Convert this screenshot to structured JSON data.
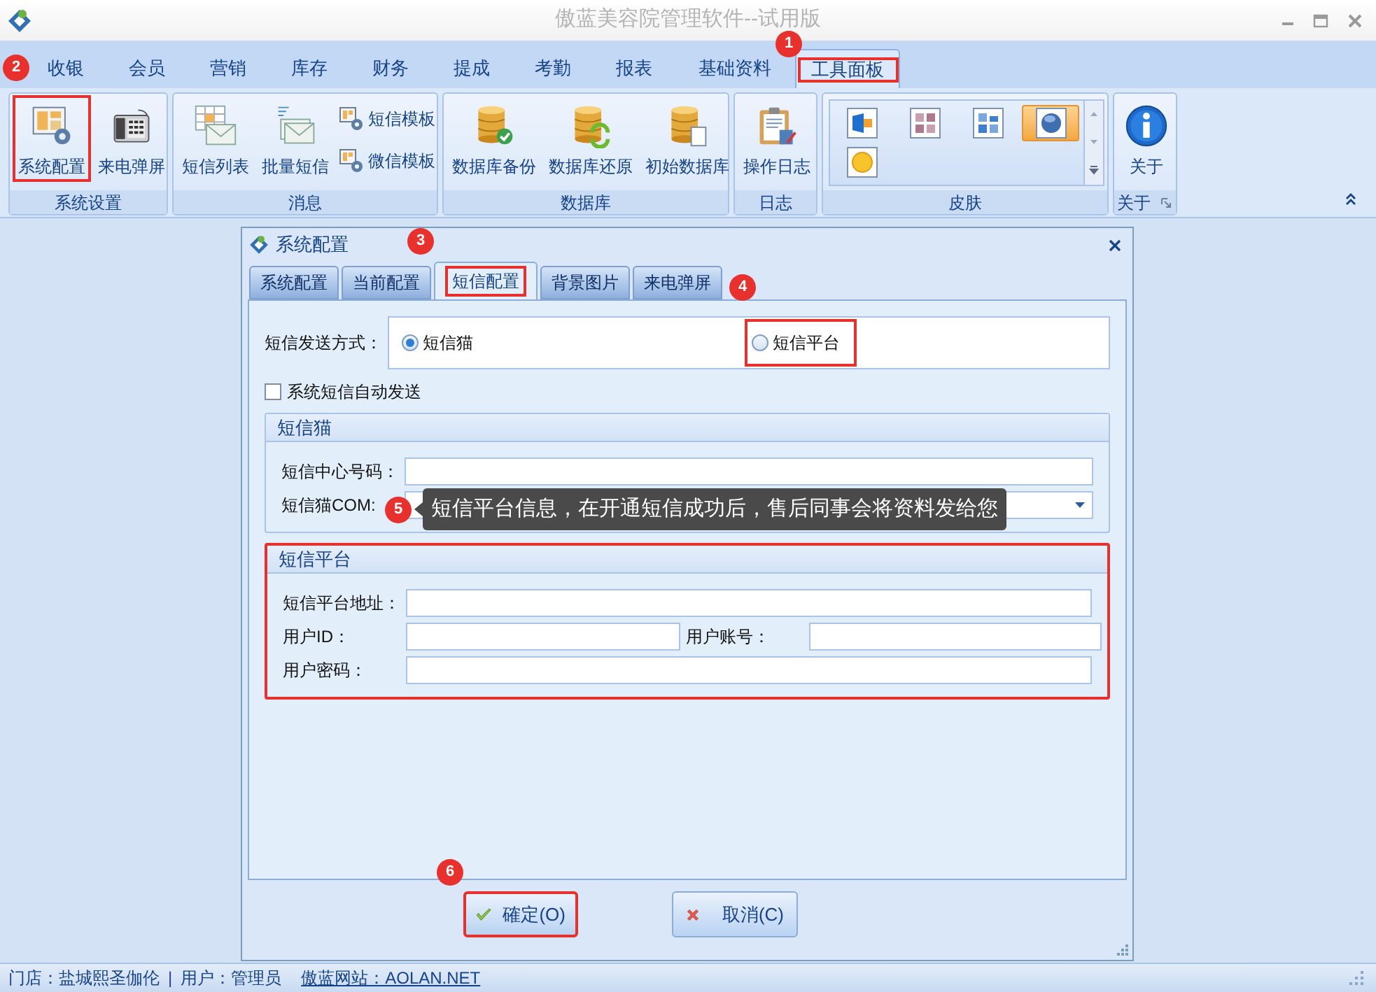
{
  "window": {
    "title": "傲蓝美容院管理软件--试用版"
  },
  "ribbon": {
    "tabs": [
      {
        "label": "收银",
        "selected": false
      },
      {
        "label": "会员",
        "selected": false
      },
      {
        "label": "营销",
        "selected": false
      },
      {
        "label": "库存",
        "selected": false
      },
      {
        "label": "财务",
        "selected": false
      },
      {
        "label": "提成",
        "selected": false
      },
      {
        "label": "考勤",
        "selected": false
      },
      {
        "label": "报表",
        "selected": false
      },
      {
        "label": "基础资料",
        "selected": false
      },
      {
        "label": "工具面板",
        "selected": true,
        "highlighted": true,
        "callout": "1"
      }
    ],
    "groups": [
      {
        "label": "系统设置",
        "kind": "buttons",
        "items": [
          {
            "label": "系统配置",
            "kind": "large",
            "highlighted": true,
            "callout": "2"
          },
          {
            "label": "来电弹屏",
            "kind": "large"
          }
        ]
      },
      {
        "label": "消息",
        "kind": "buttons",
        "items": [
          {
            "label": "短信列表",
            "kind": "large"
          },
          {
            "label": "批量短信",
            "kind": "large"
          },
          {
            "label": "短信模板",
            "kind": "small"
          },
          {
            "label": "微信模板",
            "kind": "small"
          }
        ]
      },
      {
        "label": "数据库",
        "kind": "buttons",
        "items": [
          {
            "label": "数据库备份",
            "kind": "large"
          },
          {
            "label": "数据库还原",
            "kind": "large"
          },
          {
            "label": "初始数据库",
            "kind": "large"
          }
        ]
      },
      {
        "label": "日志",
        "kind": "buttons",
        "items": [
          {
            "label": "操作日志",
            "kind": "large"
          }
        ]
      },
      {
        "label": "皮肤",
        "kind": "gallery",
        "skins": [
          {
            "selected": false
          },
          {
            "selected": false
          },
          {
            "selected": false
          },
          {
            "selected": true
          },
          {
            "selected": false
          }
        ]
      },
      {
        "label": "关于",
        "kind": "buttons",
        "launcher": true,
        "items": [
          {
            "label": "关于",
            "kind": "large"
          }
        ]
      }
    ]
  },
  "dialog": {
    "title": "系统配置",
    "tabs": [
      {
        "label": "系统配置",
        "selected": false
      },
      {
        "label": "当前配置",
        "selected": false
      },
      {
        "label": "短信配置",
        "selected": true,
        "highlighted": true,
        "callout": "3"
      },
      {
        "label": "背景图片",
        "selected": false
      },
      {
        "label": "来电弹屏",
        "selected": false,
        "callout": "4"
      }
    ],
    "send_mode": {
      "label": "短信发送方式：",
      "options": [
        {
          "label": "短信猫",
          "selected": true
        },
        {
          "label": "短信平台",
          "selected": false,
          "highlighted": true
        }
      ]
    },
    "auto_send": {
      "label": "系统短信自动发送",
      "checked": false
    },
    "groups": [
      {
        "title": "短信猫",
        "highlighted": false,
        "rows": [
          [
            {
              "label": "短信中心号码：",
              "kind": "text"
            }
          ],
          [
            {
              "label": "短信猫COM:",
              "kind": "combo"
            }
          ]
        ]
      },
      {
        "title": "短信平台",
        "highlighted": true,
        "rows": [
          [
            {
              "label": "短信平台地址：",
              "kind": "text"
            }
          ],
          [
            {
              "label": "用户ID：",
              "kind": "text"
            },
            {
              "label": "用户账号：",
              "kind": "text"
            }
          ],
          [
            {
              "label": "用户密码：",
              "kind": "text"
            }
          ]
        ]
      }
    ],
    "tooltip": {
      "text": "短信平台信息，在开通短信成功后，售后同事会将资料发给您",
      "callout": "5"
    },
    "buttons": [
      {
        "label": "確定(O)",
        "kind": "ok",
        "highlighted": true,
        "callout": "6"
      },
      {
        "label": "取消(C)",
        "kind": "cancel",
        "highlighted": false
      }
    ]
  },
  "status_bar": [
    {
      "text": "门店：盐城熙圣伽伦",
      "kind": "text"
    },
    {
      "text": "|",
      "kind": "separator"
    },
    {
      "text": "用户：管理员",
      "kind": "text"
    },
    {
      "text": "傲蓝网站：AOLAN.NET",
      "kind": "link"
    }
  ]
}
